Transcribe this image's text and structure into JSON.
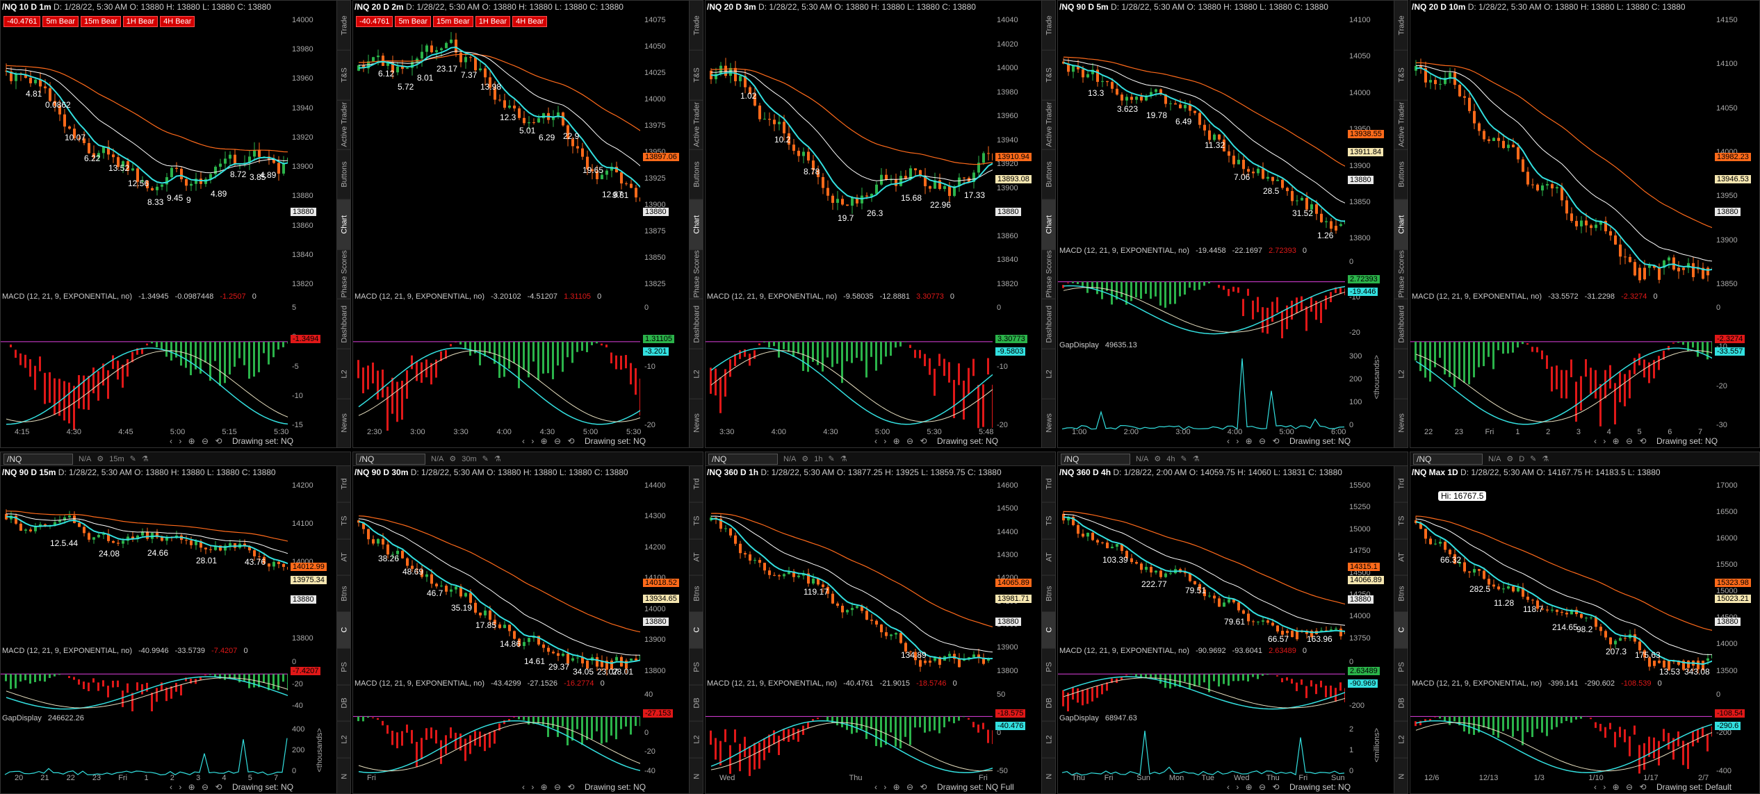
{
  "colors": {
    "bull": "#2bb34a",
    "bear": "#ff6a1a",
    "ema_fast": "#33e0e0",
    "ema_mid": "#ffffff",
    "ema_slow": "#ff6a1a",
    "macd_pos": "#2bb34a",
    "macd_neg": "#e01818",
    "volume": "#1e5aa0",
    "magenta": "#e040e0",
    "tag_red": "#d40000"
  },
  "panels": [
    {
      "title": "/NQ 10 D 1m",
      "info": "D: 1/28/22, 5:30 AM  O: 13880  H: 13880  L: 13880  C: 13880",
      "tags": [
        "-40.4761",
        "5m Bear",
        "15m Bear",
        "1H Bear",
        "4H Bear"
      ],
      "yticks": [
        "14000",
        "13980",
        "13960",
        "13940",
        "13920",
        "13900",
        "13880",
        "13860",
        "13840",
        "13820"
      ],
      "last": "13880",
      "macd": "MACD (12, 21, 9, EXPONENTIAL, no)",
      "macd_v": [
        "-1.34945",
        "-0.0987448",
        "-1.2507",
        "0"
      ],
      "macd_box": "-1.3494",
      "macd_ticks": [
        "5",
        "0",
        "-5",
        "-10",
        "-15"
      ],
      "x": [
        "4:15",
        "4:30",
        "4:45",
        "5:00",
        "5:15",
        "5:30"
      ],
      "footer": "Drawing set: NQ",
      "labels": [
        "4.81",
        "0.0862",
        "10.07",
        "6.22",
        "13.52",
        "12.56",
        "8.33",
        "9.45",
        "9",
        "4.89",
        "8.72",
        "3.85",
        "4.89"
      ],
      "side": [
        "Trade",
        "T&S",
        "Active Trader",
        "Buttons",
        "Chart",
        "Phase Scores",
        "Dashboard",
        "L2",
        "News"
      ]
    },
    {
      "title": "/NQ 20 D 2m",
      "info": "D: 1/28/22, 5:30 AM  O: 13880  H: 13880  L: 13880  C: 13880",
      "tags": [
        "-40.4761",
        "5m Bear",
        "15m Bear",
        "1H Bear",
        "4H Bear"
      ],
      "yticks": [
        "14075",
        "14050",
        "14025",
        "14000",
        "13975",
        "13950",
        "13925",
        "13900",
        "13875",
        "13850",
        "13825"
      ],
      "last": "13880",
      "box2": "13897.06",
      "macd": "MACD (12, 21, 9, EXPONENTIAL, no)",
      "macd_v": [
        "-3.20102",
        "-4.51207",
        "1.31105",
        "0"
      ],
      "macd_box": "1.31105",
      "macd_box2": "-3.201",
      "macd_ticks": [
        "0",
        "-10",
        "-20"
      ],
      "x": [
        "2:30",
        "3:00",
        "3:30",
        "4:00",
        "4:30",
        "5:00",
        "5:30"
      ],
      "footer": "Drawing set: NQ",
      "labels": [
        "6.12",
        "5.72",
        "8.01",
        "23.17",
        "7.37",
        "13.98",
        "12.3",
        "5.01",
        "6.29",
        "22.9",
        "19.65",
        "12.87",
        "9.81"
      ],
      "side": [
        "Trade",
        "T&S",
        "Active Trader",
        "Buttons",
        "Chart",
        "Phase Scores",
        "Dashboard",
        "L2",
        "News"
      ]
    },
    {
      "title": "/NQ 20 D 3m",
      "info": "D: 1/28/22, 5:30 AM  O: 13880  H: 13880  L: 13880  C: 13880",
      "tags": [],
      "yticks": [
        "14040",
        "14020",
        "14000",
        "13980",
        "13960",
        "13940",
        "13920",
        "13900",
        "13880",
        "13860",
        "13840",
        "13820"
      ],
      "last": "13880",
      "box2": "13910.94",
      "box3": "13893.08",
      "macd": "MACD (12, 21, 9, EXPONENTIAL, no)",
      "macd_v": [
        "-9.58035",
        "-12.8881",
        "3.30773",
        "0"
      ],
      "macd_box": "3.30773",
      "macd_box2": "-9.5803",
      "macd_ticks": [
        "0",
        "-10",
        "-20"
      ],
      "x": [
        "3:30",
        "4:00",
        "4:30",
        "5:00",
        "5:30",
        "5:48"
      ],
      "footer": "Drawing set: NQ",
      "labels": [
        "1.02",
        "10.2",
        "8.78",
        "19.7",
        "26.3",
        "15.68",
        "22.96",
        "17.33"
      ],
      "side": [
        "Trade",
        "T&S",
        "Active Trader",
        "Buttons",
        "Chart",
        "Phase Scores",
        "Dashboard",
        "L2",
        "News"
      ]
    },
    {
      "title": "/NQ 90 D 5m",
      "info": "D: 1/28/22, 5:30 AM  O: 13880  H: 13880  L: 13880  C: 13880",
      "tags": [],
      "yticks": [
        "14100",
        "14050",
        "14000",
        "13950",
        "13900",
        "13850",
        "13800"
      ],
      "last": "13880",
      "box2": "13938.55",
      "box3": "13911.84",
      "macd": "MACD (12, 21, 9, EXPONENTIAL, no)",
      "macd_v": [
        "-19.4458",
        "-22.1697",
        "2.72393",
        "0"
      ],
      "macd_box": "2.72393",
      "macd_box2": "-19.446",
      "macd_ticks": [
        "0",
        "-10",
        "-20"
      ],
      "gap": "GapDisplay",
      "gap_v": "49635.13",
      "gap_ticks": [
        "300",
        "200",
        "100",
        "0"
      ],
      "gap_unit": "<thousands>",
      "x": [
        "1:00",
        "2:00",
        "3:00",
        "4:00",
        "5:00",
        "6:00"
      ],
      "footer": "Drawing set: NQ",
      "labels": [
        "13.3",
        "3.623",
        "19.78",
        "6.49",
        "11.32",
        "7.06",
        "28.5",
        "31.52",
        "1.26"
      ],
      "side": [
        "Trade",
        "T&S",
        "Active Trader",
        "Buttons",
        "Chart",
        "Phase Scores",
        "Dashboard",
        "L2",
        "News"
      ]
    },
    {
      "title": "/NQ 20 D 10m",
      "info": "D: 1/28/22, 5:30 AM  O: 13880  H: 13880  L: 13880  C: 13880",
      "tags": [],
      "yticks": [
        "14150",
        "14100",
        "14050",
        "14000",
        "13950",
        "13900",
        "13850"
      ],
      "last": "13880",
      "box2": "13982.23",
      "box3": "13946.53",
      "macd": "MACD (12, 21, 9, EXPONENTIAL, no)",
      "macd_v": [
        "-33.5572",
        "-31.2298",
        "-2.3274",
        "0"
      ],
      "macd_box": "-2.3274",
      "macd_box2": "-33.557",
      "macd_ticks": [
        "0",
        "-10",
        "-20",
        "-30"
      ],
      "x": [
        "22",
        "23",
        "Fri",
        "1",
        "2",
        "3",
        "4",
        "5",
        "6",
        "7"
      ],
      "footer": "Drawing set: NQ",
      "labels": [],
      "side": []
    },
    {
      "title": "/NQ 90 D 15m",
      "info": "D: 1/28/22, 5:30 AM  O: 13880  H: 13880  L: 13880  C: 13880",
      "tags": [],
      "tb": {
        "sym": "/NQ",
        "na": "N/A",
        "period": "15m"
      },
      "yticks": [
        "14200",
        "14100",
        "14000",
        "13900",
        "13800"
      ],
      "last": "13880",
      "box2": "14012.99",
      "box3": "13975.34",
      "macd": "MACD (12, 21, 9, EXPONENTIAL, no)",
      "macd_v": [
        "-40.9946",
        "-33.5739",
        "-7.4207",
        "0"
      ],
      "macd_box": "-7.4207",
      "macd_ticks": [
        "0",
        "-20",
        "-40"
      ],
      "gap": "GapDisplay",
      "gap_v": "246622.26",
      "gap_ticks": [
        "400",
        "200",
        "0"
      ],
      "gap_unit": "<thousands>",
      "x": [
        "20",
        "21",
        "22",
        "23",
        "Fri",
        "1",
        "2",
        "3",
        "4",
        "5",
        "7"
      ],
      "footer": "Drawing set: NQ",
      "labels": [
        "12.5.44",
        "24.08",
        "24.66",
        "28.01",
        "43.76"
      ],
      "side": [
        "Trd",
        "TS",
        "AT",
        "Btns",
        "C",
        "PS",
        "DB",
        "L2",
        "N"
      ]
    },
    {
      "title": "/NQ 90 D 30m",
      "info": "D: 1/28/22, 5:30 AM  O: 13880  H: 13880  L: 13880  C: 13880",
      "tags": [],
      "tb": {
        "sym": "/NQ",
        "na": "N/A",
        "period": "30m"
      },
      "yticks": [
        "14400",
        "14300",
        "14200",
        "14100",
        "14000",
        "13900",
        "13800"
      ],
      "last": "13880",
      "box2": "14018.52",
      "box3": "13934.65",
      "macd": "MACD (12, 21, 9, EXPONENTIAL, no)",
      "macd_v": [
        "-43.4299",
        "-27.1526",
        "-16.2774",
        "0"
      ],
      "macd_box": "-27.153",
      "macd_ticks": [
        "40",
        "20",
        "0",
        "-20",
        "-40"
      ],
      "x": [
        "Fri"
      ],
      "footer": "Drawing set: NQ",
      "labels": [
        "38.26",
        "48.69",
        "46.7",
        "35.19",
        "17.85",
        "14.86",
        "14.61",
        "29.37",
        "34.05",
        "23.07",
        "28.01"
      ],
      "side": [
        "Trd",
        "TS",
        "AT",
        "Btns",
        "C",
        "PS",
        "DB",
        "L2",
        "N"
      ]
    },
    {
      "title": "/NQ 360 D 1h",
      "info": "D: 1/28/22, 5:30 AM  O: 13877.25  H: 13925  L: 13859.75  C: 13880",
      "tags": [],
      "tb": {
        "sym": "/NQ",
        "na": "N/A",
        "period": "1h"
      },
      "yticks": [
        "14600",
        "14500",
        "14400",
        "14300",
        "14200",
        "14100",
        "14000",
        "13900",
        "13800"
      ],
      "last": "13880",
      "box2": "14065.89",
      "box3": "13981.71",
      "macd": "MACD (12, 21, 9, EXPONENTIAL, no)",
      "macd_v": [
        "-40.4761",
        "-21.9015",
        "-18.5746",
        "0"
      ],
      "macd_box": "-18.575",
      "macd_box2": "-40.476",
      "macd_ticks": [
        "50",
        "0",
        "-50"
      ],
      "x": [
        "Wed",
        "Thu",
        "Fri"
      ],
      "footer": "Drawing set: NQ Full",
      "labels": [
        "119.17",
        "134.89"
      ],
      "side": [
        "Trd",
        "TS",
        "AT",
        "Btns",
        "C",
        "PS",
        "DB",
        "L2",
        "N"
      ]
    },
    {
      "title": "/NQ 360 D 4h",
      "info": "D: 1/28/22, 2:00 AM  O: 14059.75  H: 14060  L: 13831  C: 13880",
      "tags": [],
      "tb": {
        "sym": "/NQ",
        "na": "N/A",
        "period": "4h"
      },
      "yticks": [
        "15500",
        "15250",
        "15000",
        "14750",
        "14500",
        "14250",
        "14000",
        "13750"
      ],
      "last": "13880",
      "box2": "14315.1",
      "box3": "14066.89",
      "macd": "MACD (12, 21, 9, EXPONENTIAL, no)",
      "macd_v": [
        "-90.9692",
        "-93.6041",
        "2.63489",
        "0"
      ],
      "macd_box": "2.63489",
      "macd_box2": "-90.969",
      "macd_ticks": [
        "0",
        "-200"
      ],
      "gap": "GapDisplay",
      "gap_v": "68947.63",
      "gap_ticks": [
        "2",
        "1",
        "0"
      ],
      "gap_unit": "<millions>",
      "x": [
        "Thu",
        "Fri",
        "Sun",
        "Mon",
        "Tue",
        "Wed",
        "Thu",
        "Fri",
        "Sun"
      ],
      "footer": "Drawing set: NQ",
      "labels": [
        "103.39",
        "222.77",
        "79.51",
        "79.61",
        "66.57",
        "163.96"
      ],
      "side": [
        "Trd",
        "TS",
        "AT",
        "Btns",
        "C",
        "PS",
        "DB",
        "L2",
        "N"
      ]
    },
    {
      "title": "/NQ Max 1D",
      "info": "D: 1/28/22, 5:30 AM  O: 14167.75  H: 14183.5  L: 13880",
      "tags": [],
      "tb": {
        "sym": "/NQ",
        "na": "N/A",
        "period": "D"
      },
      "hi": "Hi: 16767.5",
      "yticks": [
        "17000",
        "16500",
        "16000",
        "15500",
        "15000",
        "14500",
        "14000",
        "13500"
      ],
      "last": "13880",
      "box2": "15323.98",
      "box3": "15023.21",
      "macd": "MACD (12, 21, 9, EXPONENTIAL, no)",
      "macd_v": [
        "-399.141",
        "-290.602",
        "-108.539",
        "0"
      ],
      "macd_box": "-108.54",
      "macd_box2": "-290.6",
      "macd_ticks": [
        "0",
        "-200",
        "-400"
      ],
      "x": [
        "12/6",
        "12/13",
        "1/3",
        "1/10",
        "1/17",
        "2/7"
      ],
      "footer": "Drawing set: Default",
      "labels": [
        "66.32",
        "282.5",
        "11.28",
        "118.7",
        "214.65",
        "98.2",
        "207.3",
        "175.63",
        "13.53",
        "343.08"
      ],
      "side": []
    }
  ]
}
